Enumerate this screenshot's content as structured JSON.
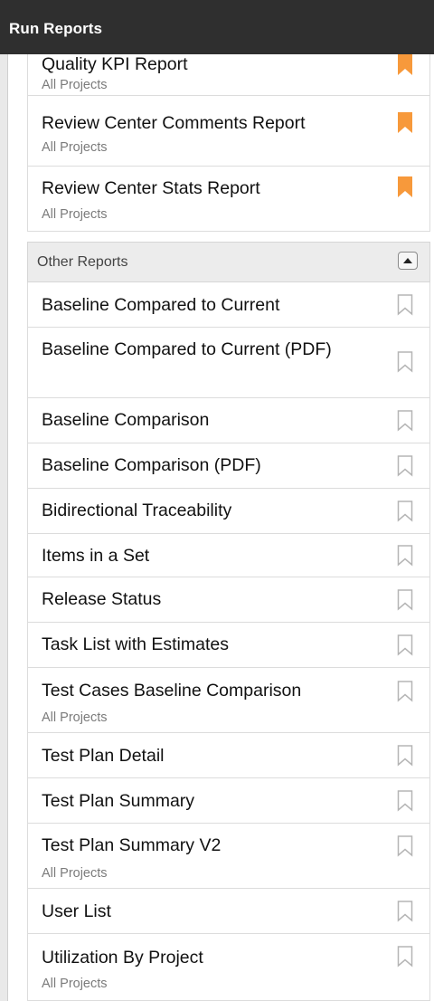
{
  "header": {
    "title": "Run Reports"
  },
  "starred": [
    {
      "name": "Quality KPI Report",
      "sub": "All Projects"
    },
    {
      "name": "Review Center Comments Report",
      "sub": "All Projects"
    },
    {
      "name": "Review Center Stats Report",
      "sub": "All Projects"
    }
  ],
  "other_section": {
    "label": "Other Reports",
    "items": [
      {
        "name": "Baseline Compared to Current",
        "sub": ""
      },
      {
        "name": "Baseline Compared to Current (PDF)",
        "sub": ""
      },
      {
        "name": "Baseline Comparison",
        "sub": ""
      },
      {
        "name": "Baseline Comparison (PDF)",
        "sub": ""
      },
      {
        "name": "Bidirectional Traceability",
        "sub": ""
      },
      {
        "name": "Items in a Set",
        "sub": ""
      },
      {
        "name": "Release Status",
        "sub": ""
      },
      {
        "name": "Task List with Estimates",
        "sub": ""
      },
      {
        "name": "Test Cases Baseline Comparison",
        "sub": "All Projects"
      },
      {
        "name": "Test Plan Detail",
        "sub": ""
      },
      {
        "name": "Test Plan Summary",
        "sub": ""
      },
      {
        "name": "Test Plan Summary V2",
        "sub": "All Projects"
      },
      {
        "name": "User List",
        "sub": ""
      },
      {
        "name": "Utilization By Project",
        "sub": "All Projects"
      }
    ]
  },
  "icons": {
    "bookmark_filled": "bookmark-filled-icon",
    "bookmark_empty": "bookmark-outline-icon",
    "collapse": "caret-up-icon"
  },
  "colors": {
    "header_bg": "#2f2f2f",
    "bookmark_filled": "#f7993b",
    "bookmark_outline": "#b5b5b5",
    "subtext": "#7b7b7b"
  }
}
